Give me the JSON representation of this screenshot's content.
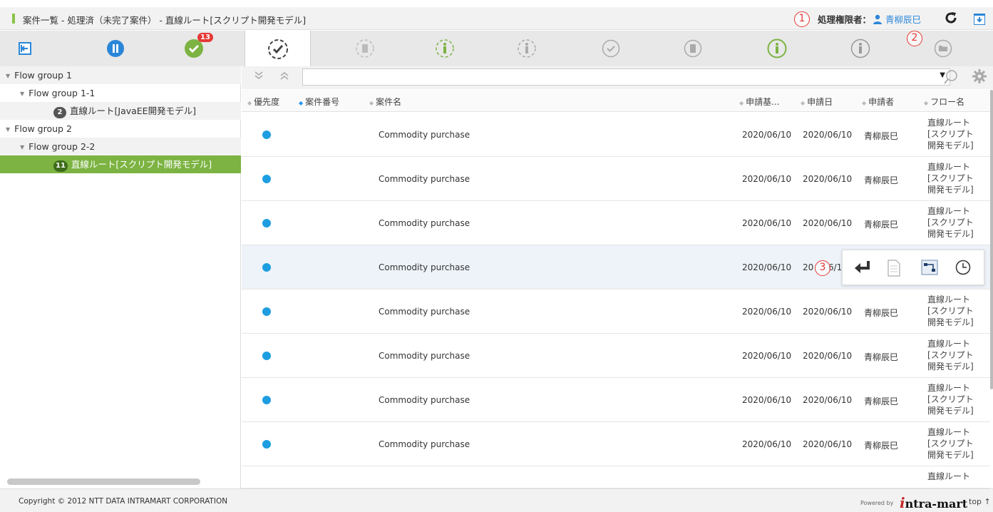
{
  "title": "案件一覧 - 処理済（未完了案件） - 直線ルート[スクリプト開発モデル]",
  "handler_label": "処理権限者：",
  "handler_user": "青柳辰巳",
  "markers": [
    "1",
    "2",
    "3"
  ],
  "toolbar": {
    "completed_badge": "13"
  },
  "sidebar": {
    "items": [
      {
        "label": "Flow group 1"
      },
      {
        "label": "Flow group 1-1"
      },
      {
        "count": "2",
        "label": "直線ルート[JavaEE開発モデル]"
      },
      {
        "label": "Flow group 2"
      },
      {
        "label": "Flow group 2-2"
      },
      {
        "count": "11",
        "label": "直線ルート[スクリプト開発モデル]"
      }
    ]
  },
  "table": {
    "headers": [
      "優先度",
      "案件番号",
      "案件名",
      "申請基...",
      "申請日",
      "申請者",
      "フロー名"
    ],
    "rows": [
      {
        "name": "Commodity purchase",
        "base": "2020/06/10",
        "date": "2020/06/10",
        "applicant": "青柳辰巳",
        "flow1": "直線ルート",
        "flow2": "[スクリプト",
        "flow3": "開発モデル]"
      },
      {
        "name": "Commodity purchase",
        "base": "2020/06/10",
        "date": "2020/06/10",
        "applicant": "青柳辰巳",
        "flow1": "直線ルート",
        "flow2": "[スクリプト",
        "flow3": "開発モデル]"
      },
      {
        "name": "Commodity purchase",
        "base": "2020/06/10",
        "date": "2020/06/10",
        "applicant": "青柳辰巳",
        "flow1": "直線ルート",
        "flow2": "[スクリプト",
        "flow3": "開発モデル]"
      },
      {
        "name": "Commodity purchase",
        "base": "2020/06/10",
        "date": "20",
        "date_tail": "6/1"
      },
      {
        "name": "Commodity purchase",
        "base": "2020/06/10",
        "date": "2020/06/10",
        "applicant": "青柳辰巳",
        "flow1": "直線ルート",
        "flow2": "[スクリプト",
        "flow3": "開発モデル]"
      },
      {
        "name": "Commodity purchase",
        "base": "2020/06/10",
        "date": "2020/06/10",
        "applicant": "青柳辰巳",
        "flow1": "直線ルート",
        "flow2": "[スクリプト",
        "flow3": "開発モデル]"
      },
      {
        "name": "Commodity purchase",
        "base": "2020/06/10",
        "date": "2020/06/10",
        "applicant": "青柳辰巳",
        "flow1": "直線ルート",
        "flow2": "[スクリプト",
        "flow3": "開発モデル]"
      },
      {
        "name": "Commodity purchase",
        "base": "2020/06/10",
        "date": "2020/06/10",
        "applicant": "青柳辰巳",
        "flow1": "直線ルート",
        "flow2": "[スクリプト",
        "flow3": "開発モデル]"
      }
    ],
    "partial_row_flow": "直線ルート"
  },
  "footer": {
    "copyright": "Copyright © 2012 NTT DATA INTRAMART CORPORATION",
    "powered_by": "Powered by",
    "brand_a": "i",
    "brand_rest": "ntra-mart",
    "top_link": "top ↑"
  },
  "colors": {
    "accent_green": "#7cb342",
    "accent_blue": "#2a86d8",
    "badge_red": "#e53935",
    "priority_dot": "#1e9ee0"
  }
}
